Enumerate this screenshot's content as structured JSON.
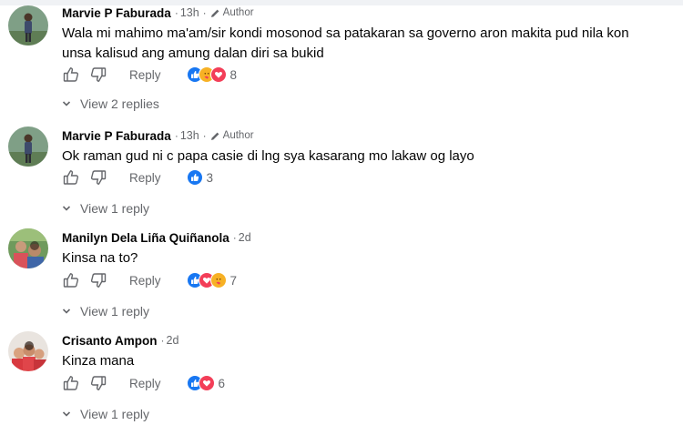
{
  "comments": [
    {
      "author": "Marvie P Faburada",
      "time": "13h",
      "badge": "Author",
      "text": "Wala mi mahimo ma'am/sir kondi mosonod sa patakaran sa governo aron makita pud nila kon unsa kalisud ang amung dalan diri sa bukid",
      "reply_label": "Reply",
      "reaction_count": "8",
      "reactions": [
        "like",
        "care",
        "love"
      ],
      "replies_label": "View 2 replies",
      "avatar": "profile-photo"
    },
    {
      "author": "Marvie P Faburada",
      "time": "13h",
      "badge": "Author",
      "text": "Ok raman gud ni c papa casie di lng sya kasarang mo lakaw og layo",
      "reply_label": "Reply",
      "reaction_count": "3",
      "reactions": [
        "like"
      ],
      "replies_label": "View 1 reply",
      "avatar": "profile-photo"
    },
    {
      "author": "Manilyn Dela Liña Quiñanola",
      "time": "2d",
      "badge": "",
      "text": "Kinsa na to?",
      "reply_label": "Reply",
      "reaction_count": "7",
      "reactions": [
        "like",
        "love",
        "care"
      ],
      "replies_label": "View 1 reply",
      "avatar": "profile-photo"
    },
    {
      "author": "Crisanto Ampon",
      "time": "2d",
      "badge": "",
      "text": "Kinza mana",
      "reply_label": "Reply",
      "reaction_count": "6",
      "reactions": [
        "like",
        "love"
      ],
      "replies_label": "View 1 reply",
      "avatar": "profile-photo"
    }
  ],
  "colors": {
    "like": "#1877f2",
    "love": "#f33e58",
    "care": "#f7b125",
    "secondary_text": "#65676b"
  }
}
